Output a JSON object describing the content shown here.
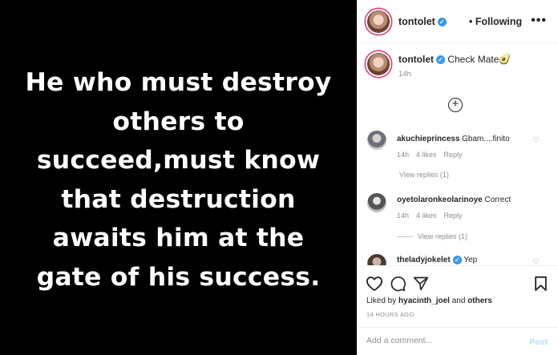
{
  "post": {
    "quote_lines": [
      "He who must destroy",
      "others to",
      "succeed,must know",
      "that destruction",
      "awaits him at the",
      "gate of his success."
    ]
  },
  "header": {
    "username": "tontolet",
    "follow_status": "• Following",
    "more_icon": "•••"
  },
  "caption": {
    "username": "tontolet",
    "text": "Check Mate",
    "emoji": "🥑",
    "time": "14h"
  },
  "load_more_icon": "+",
  "comments": [
    {
      "username": "akuchieprincess",
      "text": "Gbam....finito",
      "time": "14h",
      "likes": "4 likes",
      "reply": "Reply",
      "view_replies": "View replies (1)"
    },
    {
      "username": "oyetolaronkeolarinoye",
      "text": "Correct",
      "time": "14h",
      "likes": "4 likes",
      "reply": "Reply",
      "view_replies": "View replies (1)"
    },
    {
      "username": "theladyjokelet",
      "text": "Yep"
    }
  ],
  "actions": {
    "liked_prefix": "Liked by",
    "liked_user": "hyacinth_joel",
    "liked_and": "and",
    "liked_others": "others",
    "time": "14 HOURS AGO"
  },
  "add_comment": {
    "placeholder": "Add a comment...",
    "post_label": "Post"
  },
  "colors": {
    "accent": "#3897f0",
    "post_disabled": "#b2dffc",
    "story_ring": "#e1306c"
  }
}
